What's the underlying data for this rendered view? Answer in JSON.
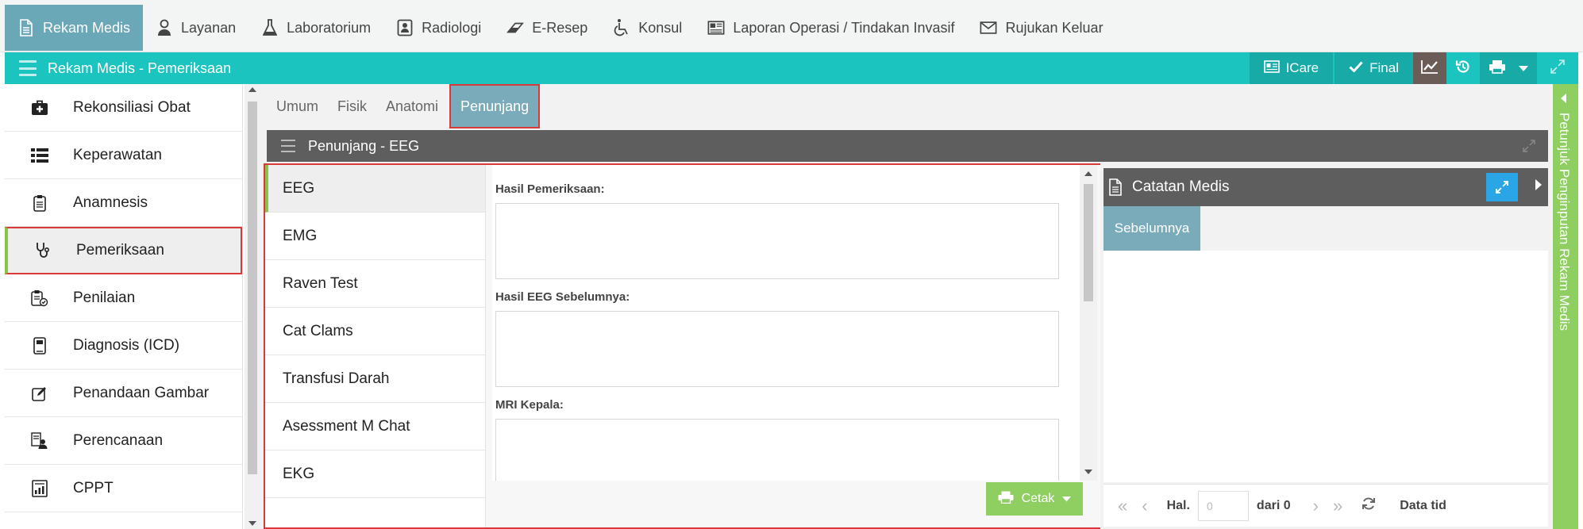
{
  "topnav": {
    "items": [
      {
        "label": "Rekam Medis",
        "icon": "file-icon",
        "active": true
      },
      {
        "label": "Layanan",
        "icon": "user-nurse-icon"
      },
      {
        "label": "Laboratorium",
        "icon": "flask-icon"
      },
      {
        "label": "Radiologi",
        "icon": "xray-icon"
      },
      {
        "label": "E-Resep",
        "icon": "pill-icon"
      },
      {
        "label": "Konsul",
        "icon": "wheelchair-icon"
      },
      {
        "label": "Laporan Operasi / Tindakan Invasif",
        "icon": "newspaper-icon"
      },
      {
        "label": "Rujukan Keluar",
        "icon": "envelope-icon"
      }
    ]
  },
  "header": {
    "title": "Rekam Medis - Pemeriksaan",
    "icare_label": "ICare",
    "final_label": "Final"
  },
  "sidebar": {
    "items": [
      {
        "label": "Rekonsiliasi Obat",
        "icon": "medkit-icon"
      },
      {
        "label": "Keperawatan",
        "icon": "list-icon"
      },
      {
        "label": "Anamnesis",
        "icon": "clipboard-icon"
      },
      {
        "label": "Pemeriksaan",
        "icon": "stethoscope-icon",
        "active": true
      },
      {
        "label": "Penilaian",
        "icon": "clipboard-check-icon"
      },
      {
        "label": "Diagnosis (ICD)",
        "icon": "phone-doc-icon"
      },
      {
        "label": "Penandaan Gambar",
        "icon": "edit-icon"
      },
      {
        "label": "Perencanaan",
        "icon": "user-doc-icon"
      },
      {
        "label": "CPPT",
        "icon": "chart-doc-icon"
      }
    ]
  },
  "tabs": [
    {
      "label": "Umum"
    },
    {
      "label": "Fisik"
    },
    {
      "label": "Anatomi"
    },
    {
      "label": "Penunjang",
      "active": true
    }
  ],
  "panel": {
    "title": "Penunjang - EEG",
    "subnav": [
      {
        "label": "EEG",
        "active": true
      },
      {
        "label": "EMG"
      },
      {
        "label": "Raven Test"
      },
      {
        "label": "Cat Clams"
      },
      {
        "label": "Transfusi Darah"
      },
      {
        "label": "Asessment M Chat"
      },
      {
        "label": "EKG"
      }
    ],
    "fields": [
      {
        "label": "Hasil Pemeriksaan:",
        "value": ""
      },
      {
        "label": "Hasil EEG Sebelumnya:",
        "value": ""
      },
      {
        "label": "MRI Kepala:",
        "value": ""
      }
    ],
    "cetak_label": "Cetak"
  },
  "catatan": {
    "title": "Catatan Medis",
    "tab_label": "Sebelumnya",
    "pager": {
      "hal_label": "Hal.",
      "page_placeholder": "0",
      "of_label": "dari 0",
      "info": "Data tid"
    }
  },
  "right_panel": {
    "label": "Petunjuk Penginputan Rekam Medis"
  },
  "colors": {
    "teal": "#1cc4c0",
    "active_tab": "#7aabbb",
    "green": "#8fcf62",
    "highlight_border": "#d83a3a"
  }
}
